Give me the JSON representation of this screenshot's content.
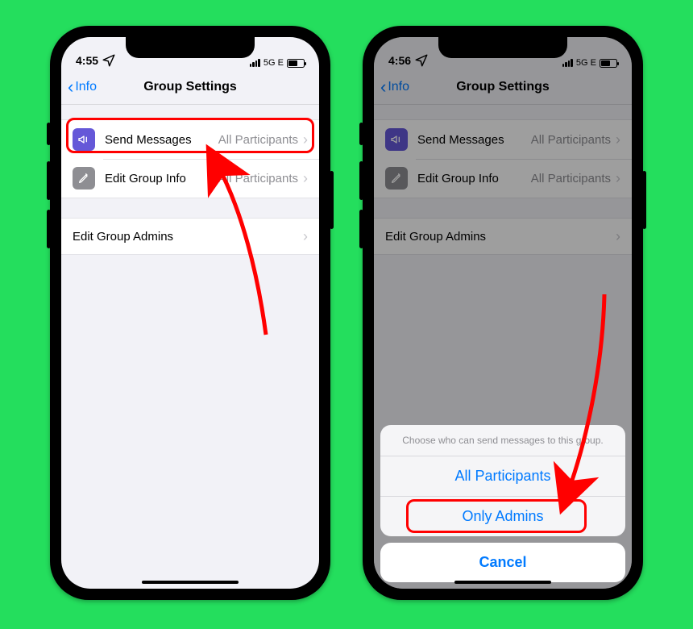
{
  "left": {
    "status": {
      "time": "4:55",
      "network": "5G E"
    },
    "nav": {
      "back": "Info",
      "title": "Group Settings"
    },
    "rows": {
      "sendMessages": {
        "label": "Send Messages",
        "value": "All Participants"
      },
      "editGroupInfo": {
        "label": "Edit Group Info",
        "value": "All Participants"
      },
      "editAdmins": {
        "label": "Edit Group Admins"
      }
    }
  },
  "right": {
    "status": {
      "time": "4:56",
      "network": "5G E"
    },
    "nav": {
      "back": "Info",
      "title": "Group Settings"
    },
    "rows": {
      "sendMessages": {
        "label": "Send Messages",
        "value": "All Participants"
      },
      "editGroupInfo": {
        "label": "Edit Group Info",
        "value": "All Participants"
      },
      "editAdmins": {
        "label": "Edit Group Admins"
      }
    },
    "sheet": {
      "header": "Choose who can send messages to this group.",
      "option1": "All Participants",
      "option2": "Only Admins",
      "cancel": "Cancel"
    }
  }
}
